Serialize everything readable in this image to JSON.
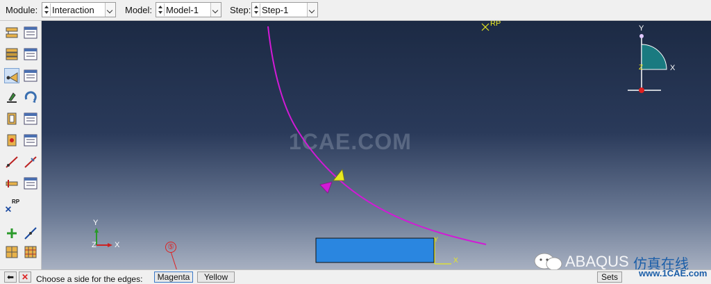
{
  "context": {
    "module_label": "Module:",
    "module_value": "Interaction",
    "model_label": "Model:",
    "model_value": "Model-1",
    "step_label": "Step:",
    "step_value": "Step-1"
  },
  "viewport": {
    "watermark": "1CAE.COM",
    "rp_label": "RP",
    "triad_main": {
      "y": "Y",
      "x": "X",
      "z": "Z"
    },
    "triad_corner": {
      "y": "Y",
      "x": "X",
      "z": "Z"
    },
    "triad_part": {
      "y": "Y",
      "x": "X"
    },
    "curve_color": "#d21ad6",
    "rect_color": "#2a86e0",
    "arrow_color": "#e8e820"
  },
  "toolbox": {
    "rp_tool_label": "RP"
  },
  "prompt": {
    "text": "Choose a side for the edges:",
    "option_magenta": "Magenta",
    "option_yellow": "Yellow",
    "sets_button": "Sets",
    "callout_number": "⑤"
  },
  "overlay": {
    "abaqus": "ABAQUS",
    "chinese": "仿真在线",
    "site": "www.1CAE.com"
  }
}
